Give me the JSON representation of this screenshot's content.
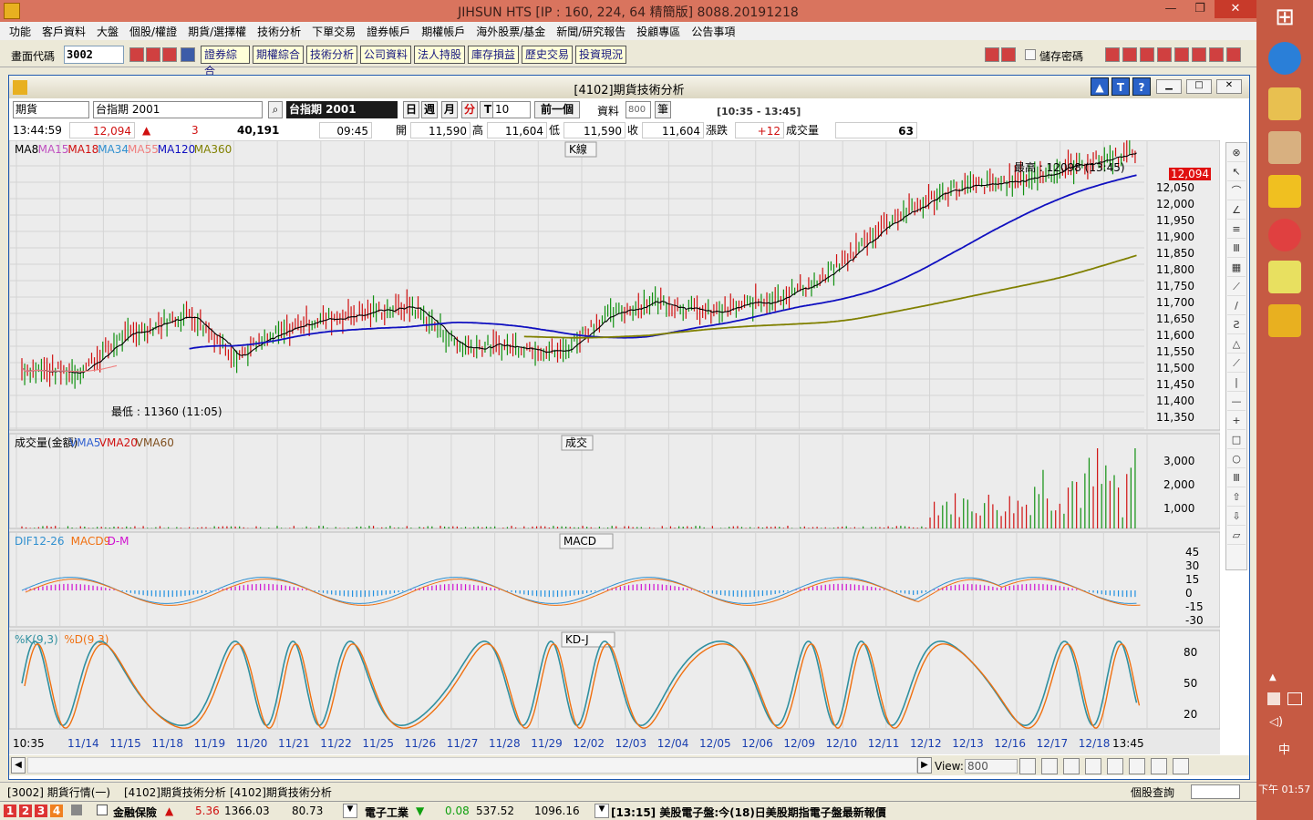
{
  "window": {
    "title": "JIHSUN HTS    [IP : 160, 224, 64 精簡版] 8088.20191218"
  },
  "menu": [
    "功能",
    "客戶資料",
    "大盤",
    "個股/權證",
    "期貨/選擇權",
    "技術分析",
    "下單交易",
    "證券帳戶",
    "期權帳戶",
    "海外股票/基金",
    "新聞/研究報告",
    "投顧專區",
    "公告事項"
  ],
  "toolbar": {
    "code_label": "畫面代碼",
    "code_value": "3002",
    "nav": [
      "證券綜合",
      "期權綜合",
      "技術分析",
      "公司資料",
      "法人持股",
      "庫存損益",
      "歷史交易",
      "投資現況"
    ],
    "save_pw": "儲存密碼"
  },
  "subwin": {
    "title": "[4102]期貨技術分析"
  },
  "controls": {
    "type": "期貨",
    "symbol": "台指期 2001",
    "symbol_dark": "台指期 2001",
    "periods": [
      "日",
      "週",
      "月",
      "分",
      "T"
    ],
    "minutes": "10",
    "prev": "前一個",
    "data_label": "資料",
    "data_count": "800",
    "unit": "筆",
    "time_range": "[10:35 - 13:45]"
  },
  "quote": {
    "time": "13:44:59",
    "price": "12,094",
    "change": "3",
    "volume_total": "40,191",
    "bar_time": "09:45",
    "open_label": "開",
    "open": "11,590",
    "high_label": "高",
    "high": "11,604",
    "low_label": "低",
    "low": "11,590",
    "close_label": "收",
    "close": "11,604",
    "chg_label": "漲跌",
    "chg": "+12",
    "vol_label": "成交量",
    "vol": "63"
  },
  "kline": {
    "legend": [
      "MA8",
      "MA15",
      "MA18",
      "MA34",
      "MA55",
      "MA120",
      "MA360"
    ],
    "legend_colors": [
      "#000000",
      "#c050c0",
      "#d01010",
      "#3090d0",
      "#f08080",
      "#1010c0",
      "#808000"
    ],
    "title": "K線",
    "high_note": "最高 : 12098 (13:45)",
    "low_note": "最低 : 11360 (11:05)",
    "last_tag": "12,094",
    "yticks": [
      "12,050",
      "12,000",
      "11,950",
      "11,900",
      "11,850",
      "11,800",
      "11,750",
      "11,700",
      "11,650",
      "11,600",
      "11,550",
      "11,500",
      "11,450",
      "11,400",
      "11,350"
    ]
  },
  "volume": {
    "legend": [
      "成交量(金額)",
      "VMA5",
      "VMA20",
      "VMA60"
    ],
    "legend_colors": [
      "#000000",
      "#3060d0",
      "#d01010",
      "#805020"
    ],
    "title": "成交",
    "yticks": [
      "3,000",
      "2,000",
      "1,000"
    ]
  },
  "macd": {
    "legend": [
      "DIF12-26",
      "MACD9",
      "D-M"
    ],
    "legend_colors": [
      "#3090d0",
      "#f07010",
      "#d010d0"
    ],
    "title": "MACD",
    "yticks": [
      "45",
      "30",
      "15",
      "0",
      "-15",
      "-30"
    ]
  },
  "kd": {
    "legend": [
      "%K(9,3)",
      "%D(9,3)"
    ],
    "legend_colors": [
      "#3090a0",
      "#f07010"
    ],
    "title": "KD-J",
    "yticks": [
      "80",
      "50",
      "20"
    ]
  },
  "xaxis": {
    "start": "10:35",
    "end": "13:45",
    "dates": [
      "11/14",
      "11/15",
      "11/18",
      "11/19",
      "11/20",
      "11/21",
      "11/22",
      "11/25",
      "11/26",
      "11/27",
      "11/28",
      "11/29",
      "12/02",
      "12/03",
      "12/04",
      "12/05",
      "12/06",
      "12/09",
      "12/10",
      "12/11",
      "12/12",
      "12/13",
      "12/16",
      "12/17",
      "12/18"
    ]
  },
  "view": {
    "label": "View:",
    "value": "800"
  },
  "tabs": [
    "[3002] 期貨行情(一)",
    "[4102]期貨技術分析",
    "[4102]期貨技術分析"
  ],
  "tabs_right": "個股查詢",
  "status": {
    "pages": [
      "1",
      "2",
      "3",
      "4"
    ],
    "sector1": "金融保險",
    "s1_chg": "5.36",
    "s1_idx": "1366.03",
    "s1_val": "80.73",
    "sector2": "電子工業",
    "s2_chg": "0.08",
    "s2_idx": "537.52",
    "s2_val": "1096.16",
    "news": "[13:15] 美股電子盤:今(18)日美股期指電子盤最新報價"
  },
  "clock": {
    "label": "下午 01:57",
    "tray": "中"
  }
}
